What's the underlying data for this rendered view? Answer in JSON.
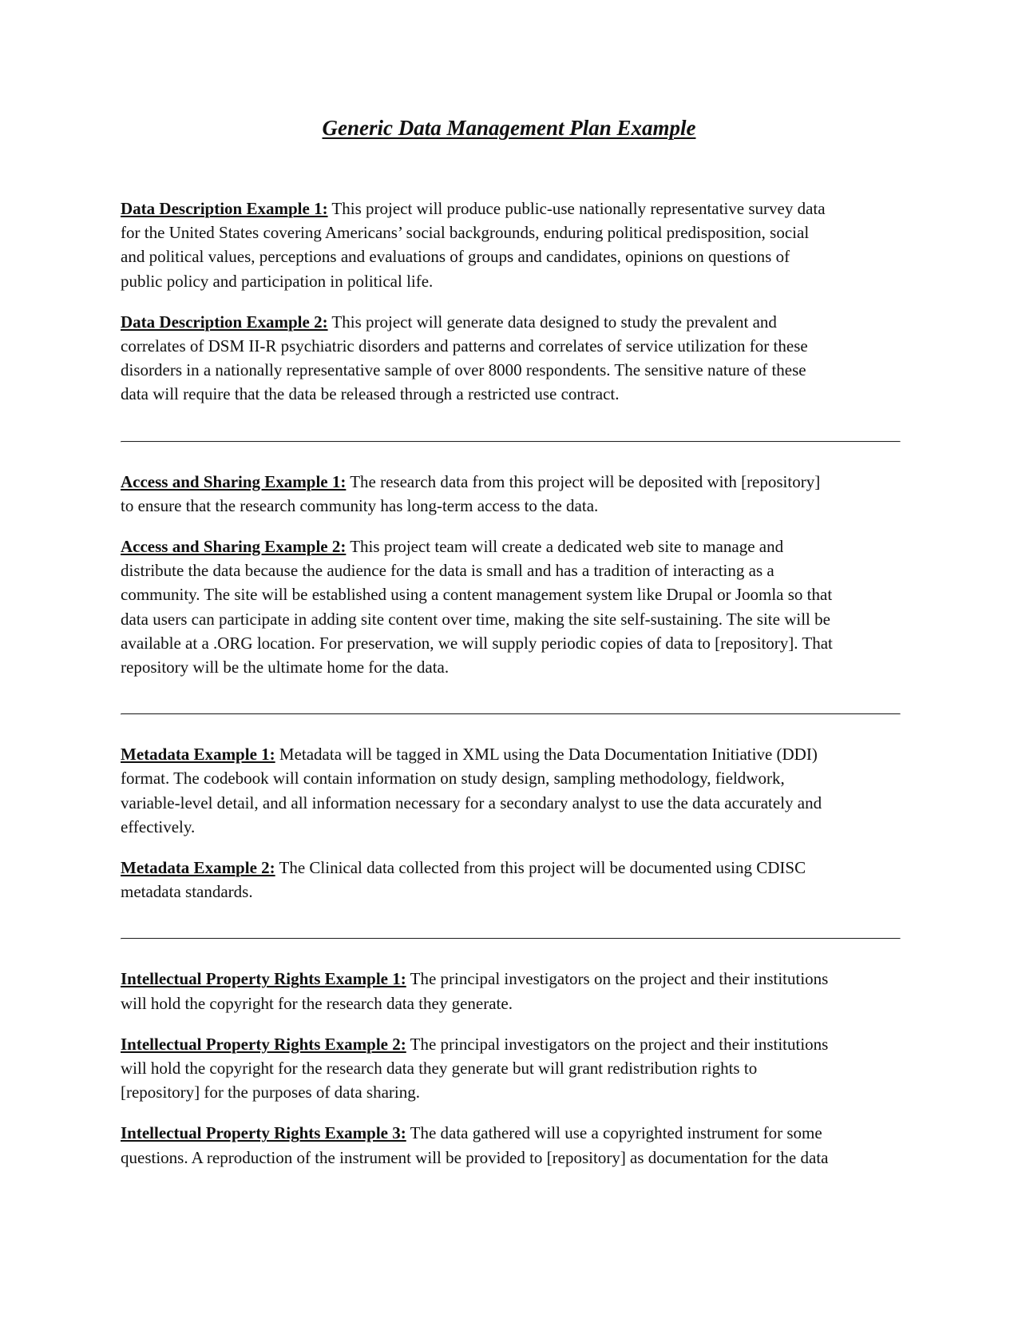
{
  "document": {
    "title": "Generic Data Management Plan Example"
  },
  "sections": [
    {
      "name": "data-description",
      "examples": [
        {
          "label": "Data Description Example 1:",
          "lines": [
            " This project will produce public-use nationally representative survey data",
            "for the United States covering Americans’ social backgrounds, enduring political predisposition, social",
            "and political values, perceptions and evaluations of groups and candidates, opinions on questions of",
            "public policy and participation in political life."
          ]
        },
        {
          "label": "Data Description Example 2:",
          "lines": [
            " This project will generate data designed to study the prevalent and",
            "correlates of DSM II-R psychiatric disorders and patterns and correlates of service utilization for these",
            "disorders in a nationally representative sample of over 8000 respondents. The sensitive nature of these",
            "data will require that the data be released through a restricted use contract."
          ]
        }
      ]
    },
    {
      "name": "access-and-sharing",
      "examples": [
        {
          "label": "Access and Sharing Example 1:",
          "lines": [
            " The research data from this project will be deposited with [repository]",
            "to ensure that the research community has long-term access to the data."
          ]
        },
        {
          "label": "Access and Sharing Example 2:",
          "lines": [
            " This project team will create a dedicated web site to manage and",
            "distribute the data because the audience for the data is small and has a tradition of interacting as a",
            "community. The site will be established using a content management system like Drupal or Joomla so that",
            "data users can participate in adding site content over time, making the site self-sustaining. The site will be",
            "available at a .ORG location. For preservation, we will supply periodic copies of data to [repository]. That",
            "repository will be the ultimate home for the data."
          ]
        }
      ]
    },
    {
      "name": "metadata",
      "examples": [
        {
          "label": "Metadata Example 1:",
          "lines": [
            " Metadata will be tagged in XML using the Data Documentation Initiative (DDI)",
            "format. The codebook will contain information on study design, sampling methodology, fieldwork,",
            "variable-level detail, and all information necessary for a secondary analyst to use the data accurately and",
            "effectively."
          ]
        },
        {
          "label": "Metadata Example 2:",
          "lines": [
            " The Clinical data collected from this project will be documented using CDISC",
            "metadata standards."
          ]
        }
      ]
    },
    {
      "name": "intellectual-property-rights",
      "examples": [
        {
          "label": "Intellectual Property Rights Example 1:",
          "lines": [
            " The principal investigators on the project and their institutions",
            "will hold the copyright for the research data they generate."
          ]
        },
        {
          "label": "Intellectual Property Rights Example 2:",
          "lines": [
            " The principal investigators on the project and their institutions",
            "will hold the copyright for the research data they generate but will grant redistribution rights to",
            "[repository] for the purposes of data sharing."
          ]
        },
        {
          "label": "Intellectual Property Rights Example 3:",
          "lines": [
            " The data gathered will use a copyrighted instrument for some",
            "questions. A reproduction of the instrument will be provided to [repository] as documentation for the data"
          ]
        }
      ]
    }
  ]
}
